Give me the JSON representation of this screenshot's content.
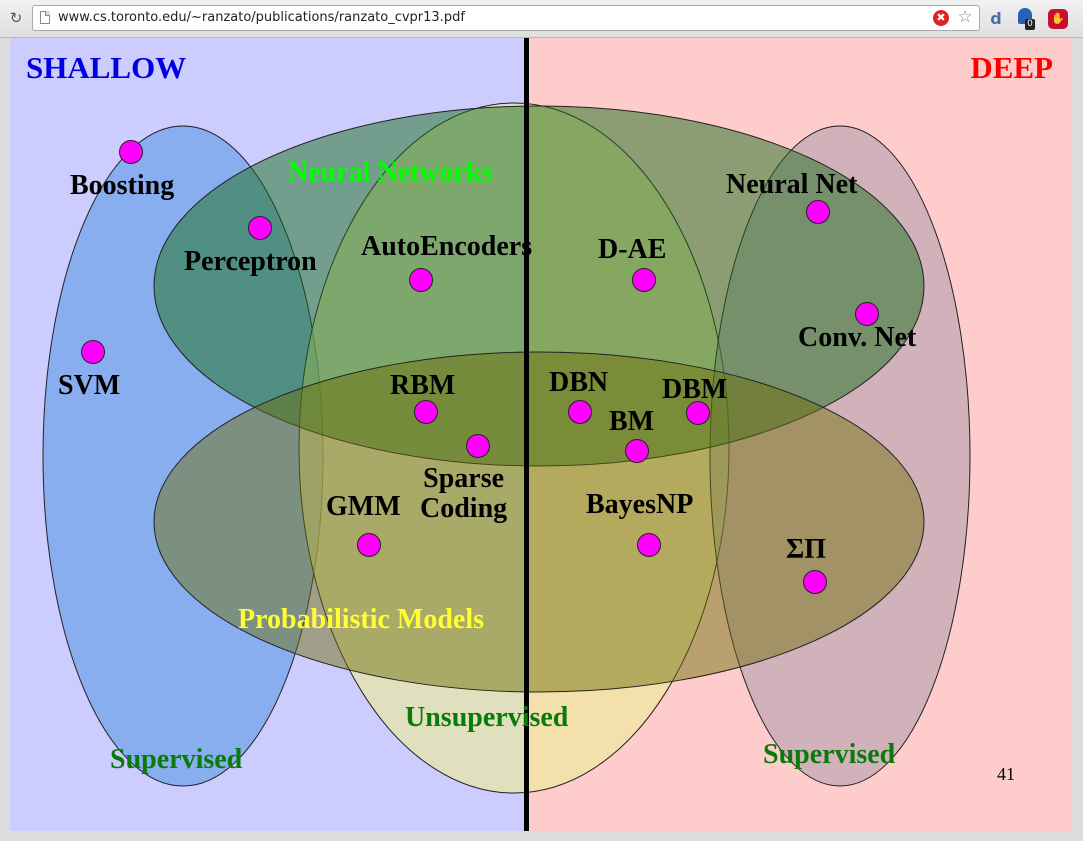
{
  "browser": {
    "url": "www.cs.toronto.edu/~ranzato/publications/ranzato_cvpr13.pdf",
    "reload_icon": "reload-icon",
    "ghostery_badge": "0"
  },
  "slide": {
    "title_left": "SHALLOW",
    "title_right": "DEEP",
    "page_number": "41",
    "colors": {
      "shallow_bg": "#ccccff",
      "deep_bg": "#ffcccc",
      "dot": "#ff00ff"
    },
    "sets": {
      "neural_networks": "Neural Networks",
      "probabilistic_models": "Probabilistic Models",
      "supervised_left": "Supervised",
      "unsupervised": "Unsupervised",
      "supervised_right": "Supervised"
    },
    "items": {
      "boosting": "Boosting",
      "perceptron": "Perceptron",
      "autoencoders": "AutoEncoders",
      "d_ae": "D-AE",
      "neural_net": "Neural Net",
      "svm": "SVM",
      "conv_net": "Conv. Net",
      "rbm": "RBM",
      "dbn": "DBN",
      "dbm": "DBM",
      "bm": "BM",
      "sparse_coding_line1": "Sparse",
      "sparse_coding_line2": "Coding",
      "gmm": "GMM",
      "bayesnp": "BayesNP",
      "sum_product": "ΣΠ"
    }
  }
}
